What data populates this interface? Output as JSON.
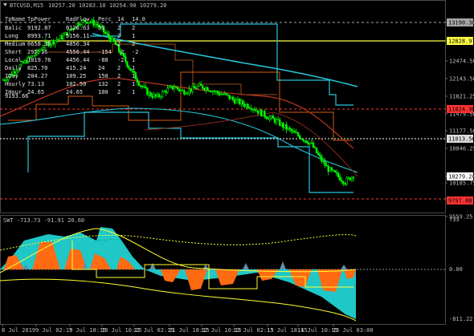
{
  "window": {
    "symbol_label": "BTCUSD,M15",
    "ohlc": "10257.20 10283.10 10254.90 10279.20"
  },
  "stats_table": {
    "headers": [
      "TpName",
      "TpPower",
      "RadFlow",
      "Perc",
      "14",
      "14.0"
    ],
    "rows": [
      [
        "Balic",
        "9192.87",
        "6126.63",
        "37",
        "2",
        "2"
      ],
      [
        "Long",
        "8993.71",
        "5156.11",
        "",
        "2",
        "1"
      ],
      [
        "Medium",
        "6658.35",
        "4856.34",
        "",
        "2",
        "2"
      ],
      [
        "Short",
        "295.16",
        "4556.44",
        "-154",
        "-2",
        "-2"
      ],
      [
        "Local",
        "1819.76",
        "4456.44",
        "-88",
        "-2",
        "1"
      ],
      [
        "Daily",
        "825.70",
        "415.24",
        "24",
        "2",
        "1"
      ],
      [
        "IDay",
        "204.27",
        "109.25",
        "150",
        "2",
        "1"
      ],
      [
        "Hourly",
        "73.13",
        "102.50",
        "132",
        "2",
        "1"
      ],
      [
        "IHour",
        "24.65",
        "24.65",
        "100",
        "2",
        "1"
      ]
    ],
    "extra_label": "9193.66"
  },
  "price_axis": {
    "labels": [
      "13190.30",
      "12828.97",
      "12474.50",
      "12143.50",
      "11821.25",
      "11479.50",
      "11177.50",
      "10846.25",
      "10279.20",
      "10185.75",
      "9889.37",
      "9559.25"
    ]
  },
  "price_tags": [
    {
      "text": "13190.30",
      "color": "#a8a8a8"
    },
    {
      "text": "12828.97",
      "color": "#ffff44"
    },
    {
      "text": "11824.90",
      "color": "#ff3333"
    },
    {
      "text": "11013.56",
      "color": "#dddddd"
    },
    {
      "text": "10279.20",
      "color": "#ffffff"
    },
    {
      "text": "9797.88",
      "color": "#ff3333"
    }
  ],
  "time_axis": {
    "labels": [
      "8 Jul 2019",
      "9 Jul 02:15",
      "9 Jul 18:15",
      "10 Jul 10:15",
      "11 Jul 02:15",
      "11 Jul 18:15",
      "12 Jul 10:15",
      "13 Jul 02:15",
      "13 Jul 18:15",
      "14 Jul 10:15",
      "15 Jul 03:00"
    ]
  },
  "indicator": {
    "label": "SWT -713.73 -91.91 20.60",
    "axis_labels": [
      "733",
      "0.00",
      "-811.22"
    ]
  },
  "colors": {
    "candle": "#00ff00",
    "cyan": "#26c6da",
    "teal_fill": "#1fc7c7",
    "orange": "#ff6a13",
    "yellow": "#ffff33",
    "red_level": "#ff3333",
    "steel": "#5f8fa8",
    "grid": "#1c1c1c"
  },
  "chart_data": {
    "type": "candlestick",
    "title": "BTCUSD,M15",
    "close_series": [
      12080,
      12200,
      12350,
      12480,
      12600,
      12760,
      12820,
      12900,
      13050,
      13180,
      13200,
      13120,
      12950,
      12780,
      12520,
      12250,
      12000,
      11820,
      11750,
      11880,
      11950,
      11860,
      11900,
      11960,
      11920,
      11840,
      11790,
      11700,
      11630,
      11580,
      11470,
      11380,
      11300,
      11180,
      11080,
      10980,
      10880,
      10620,
      10400,
      10280,
      10150,
      10279
    ]
  }
}
